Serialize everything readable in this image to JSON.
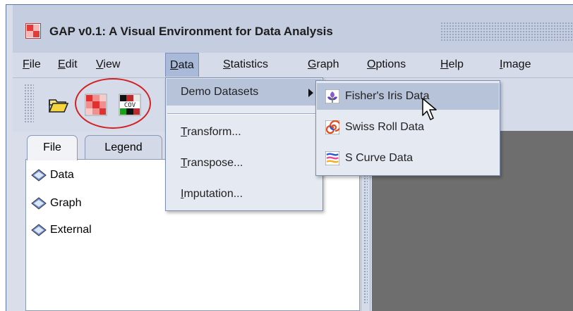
{
  "window": {
    "title": "GAP v0.1: A Visual Environment for Data Analysis"
  },
  "menubar": {
    "items": [
      {
        "label": "File",
        "mnemonic": "F",
        "rest": "ile"
      },
      {
        "label": "Edit",
        "mnemonic": "E",
        "rest": "dit"
      },
      {
        "label": "View",
        "mnemonic": "V",
        "rest": "iew"
      },
      {
        "label": "Data",
        "mnemonic": "D",
        "rest": "ata"
      },
      {
        "label": "Statistics",
        "mnemonic": "S",
        "rest": "tatistics"
      },
      {
        "label": "Graph",
        "mnemonic": "G",
        "rest": "raph"
      },
      {
        "label": "Options",
        "mnemonic": "O",
        "rest": "ptions"
      },
      {
        "label": "Help",
        "mnemonic": "H",
        "rest": "elp"
      },
      {
        "label": "Image",
        "mnemonic": "I",
        "rest": "mage"
      }
    ]
  },
  "toolbar": {
    "open_icon": "folder-open-icon",
    "heatmap_icon": "heatmap-icon",
    "cov_label": "COV"
  },
  "data_menu": {
    "demo": "Demo Datasets",
    "transform": {
      "mnemonic": "T",
      "rest": "ransform..."
    },
    "transpose": {
      "mnemonic": "T",
      "rest": "ranspose..."
    },
    "imputation": {
      "mnemonic": "I",
      "rest": "mputation..."
    }
  },
  "demo_menu": {
    "items": [
      {
        "label": "Fisher's Iris Data",
        "icon": "iris-icon"
      },
      {
        "label": "Swiss Roll Data",
        "icon": "swiss-roll-icon"
      },
      {
        "label": "S Curve Data",
        "icon": "s-curve-icon"
      }
    ]
  },
  "left_panel": {
    "tabs": [
      "File",
      "Legend"
    ],
    "tree": [
      "Data",
      "Graph",
      "External"
    ]
  },
  "colors": {
    "menu_highlight": "#b7c3d9",
    "annotation_circle": "#d32222",
    "workspace": "#6e6e6e"
  }
}
